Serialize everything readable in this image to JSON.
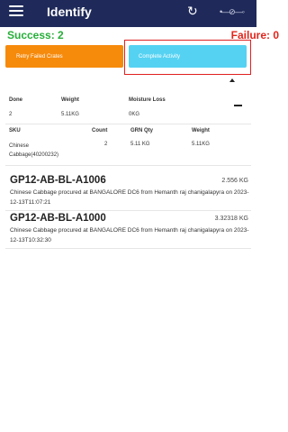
{
  "appbar": {
    "title": "Identify",
    "refresh_icon": "refresh-icon",
    "usb_icon": "usb-icon"
  },
  "status": {
    "success": "Success: 2",
    "failure": "Failure: 0",
    "success_color": "#27ae3a",
    "failure_color": "#e1251b"
  },
  "actions": {
    "retry_label": "Retry Failed Crates",
    "complete_label": "Complete Activity"
  },
  "summary": {
    "headers": {
      "done": "Done",
      "weight": "Weight",
      "moisture": "Moisture Loss"
    },
    "values": {
      "done": "2",
      "weight": "5.11KG",
      "moisture": "0KG"
    }
  },
  "sku_table": {
    "headers": {
      "sku": "SKU",
      "count": "Count",
      "grn": "GRN Qty",
      "weight": "Weight"
    },
    "row": {
      "sku": "Chinese Cabbage(40200232)",
      "count": "2",
      "grn": "5.11 KG",
      "weight": "5.11KG"
    }
  },
  "crates": [
    {
      "code": "GP12-AB-BL-A1006",
      "weight": "2.556 KG",
      "description": "Chinese Cabbage procured at BANGALORE DC6 from Hemanth raj chanigalapyra on 2023-12-13T11:07:21"
    },
    {
      "code": "GP12-AB-BL-A1000",
      "weight": "3.32318 KG",
      "description": "Chinese Cabbage procured at BANGALORE DC6 from Hemanth raj chanigalapyra on 2023-12-13T10:32:30"
    }
  ]
}
